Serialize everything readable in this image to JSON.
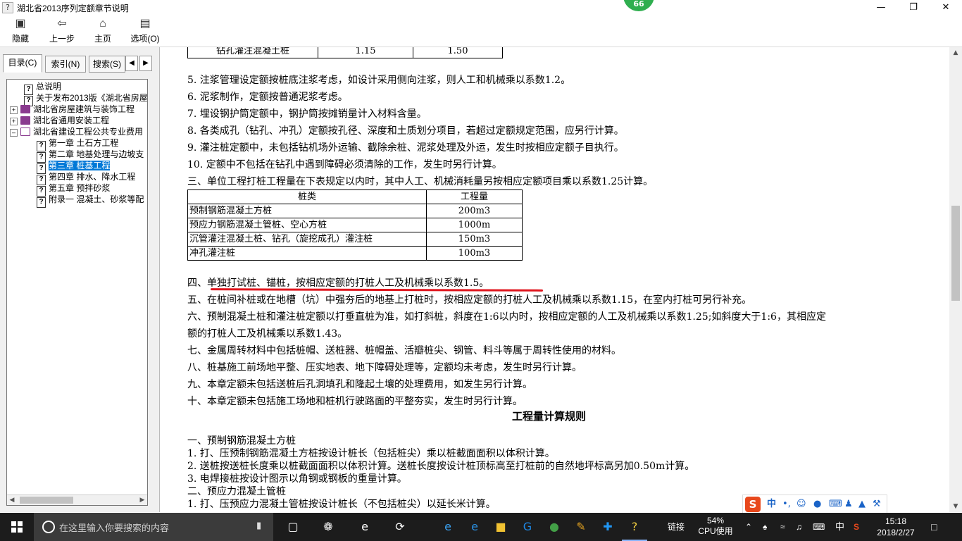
{
  "window": {
    "title": "湖北省2013序列定额章节说明",
    "badge": "66"
  },
  "toolbar": {
    "hide": "隐藏",
    "back": "上一步",
    "home": "主页",
    "options": "选项(O)"
  },
  "tabs": {
    "contents": "目录(C)",
    "index": "索引(N)",
    "search": "搜索(S)"
  },
  "tree": [
    {
      "label": "总说明"
    },
    {
      "label": "关于发布2013版《湖北省房屋"
    },
    {
      "label": "湖北省房屋建筑与装饰工程"
    },
    {
      "label": "湖北省通用安装工程"
    },
    {
      "label": "湖北省建设工程公共专业费用"
    },
    {
      "label": "第一章 土石方工程"
    },
    {
      "label": "第二章 地基处理与边坡支"
    },
    {
      "label": "第三章 桩基工程"
    },
    {
      "label": "第四章 排水、降水工程"
    },
    {
      "label": "第五章 预拌砂浆"
    },
    {
      "label": "附录一 混凝土、砂浆等配"
    }
  ],
  "top_table": {
    "row": [
      "钻孔灌注混凝土桩",
      "1.15",
      "1.50"
    ]
  },
  "lines_a": [
    "5. 注浆管理设定额按桩底注浆考虑，如设计采用侧向注浆，则人工和机械乘以系数1.2。",
    "6. 泥浆制作，定额按普通泥浆考虑。",
    "7. 埋设钢护筒定额中，钢护筒按摊销量计入材料含量。",
    "8. 各类成孔（钻孔、冲孔）定额按孔径、深度和土质划分项目，若超过定额规定范围，应另行计算。",
    "9. 灌注桩定额中，未包括钻机场外运输、截除余桩、泥浆处理及外运，发生时按相应定额子目执行。",
    "10. 定额中不包括在钻孔中遇到障碍必须清除的工作，发生时另行计算。",
    "三、单位工程打桩工程量在下表规定以内时，其中人工、机械消耗量另按相应定额项目乘以系数1.25计算。"
  ],
  "pile_table": {
    "header": [
      "桩类",
      "工程量"
    ],
    "rows": [
      [
        "预制钢筋混凝土方桩",
        "200m3"
      ],
      [
        "预应力钢筋混凝土管桩、空心方桩",
        "1000m"
      ],
      [
        "沉管灌注混凝土桩、钻孔（旋挖成孔）灌注桩",
        "150m3"
      ],
      [
        "冲孔灌注桩",
        "100m3"
      ]
    ]
  },
  "lines_b": [
    "四、单独打试桩、锚桩，按相应定额的打桩人工及机械乘以系数1.5。",
    "五、在桩间补桩或在地槽（坑）中强夯后的地基上打桩时，按相应定额的打桩人工及机械乘以系数1.15，在室内打桩可另行补充。",
    "六、预制混凝土桩和灌注桩定额以打垂直桩为准，如打斜桩，斜度在1:6以内时，按相应定额的人工及机械乘以系数1.25;如斜度大于1:6，其相应定",
    "额的打桩人工及机械乘以系数1.43。",
    "七、金属周转材料中包括桩帽、送桩器、桩帽盖、活瓣桩尖、钢管、料斗等属于周转性使用的材料。",
    "八、桩基施工前场地平整、压实地表、地下障碍处理等，定额均未考虑，发生时另行计算。",
    "九、本章定额未包括送桩后孔洞填孔和隆起土壤的处理费用，如发生另行计算。",
    "十、本章定额未包括施工场地和桩机行驶路面的平整夯实，发生时另行计算。"
  ],
  "heading": "工程量计算规则",
  "lines_c": [
    "一、预制钢筋混凝土方桩",
    "1. 打、压预制钢筋混凝土方桩按设计桩长（包括桩尖）乘以桩截面面积以体积计算。",
    "2. 送桩按送桩长度乘以桩截面面积以体积计算。送桩长度按设计桩顶标高至打桩前的自然地坪标高另加0.50m计算。",
    "3. 电焊接桩按设计图示以角钢或钢板的重量计算。",
    "二、预应力混凝土管桩",
    "1. 打、压预应力混凝土管桩按设计桩长（不包括桩尖）以延长米计算。"
  ],
  "ime": {
    "lang": "中"
  },
  "taskbar": {
    "search_placeholder": "在这里输入你要搜索的内容",
    "link": "链接",
    "cpu_percent": "54%",
    "cpu_label": "CPU使用",
    "lang": "中",
    "time": "15:18",
    "date": "2018/2/27"
  }
}
